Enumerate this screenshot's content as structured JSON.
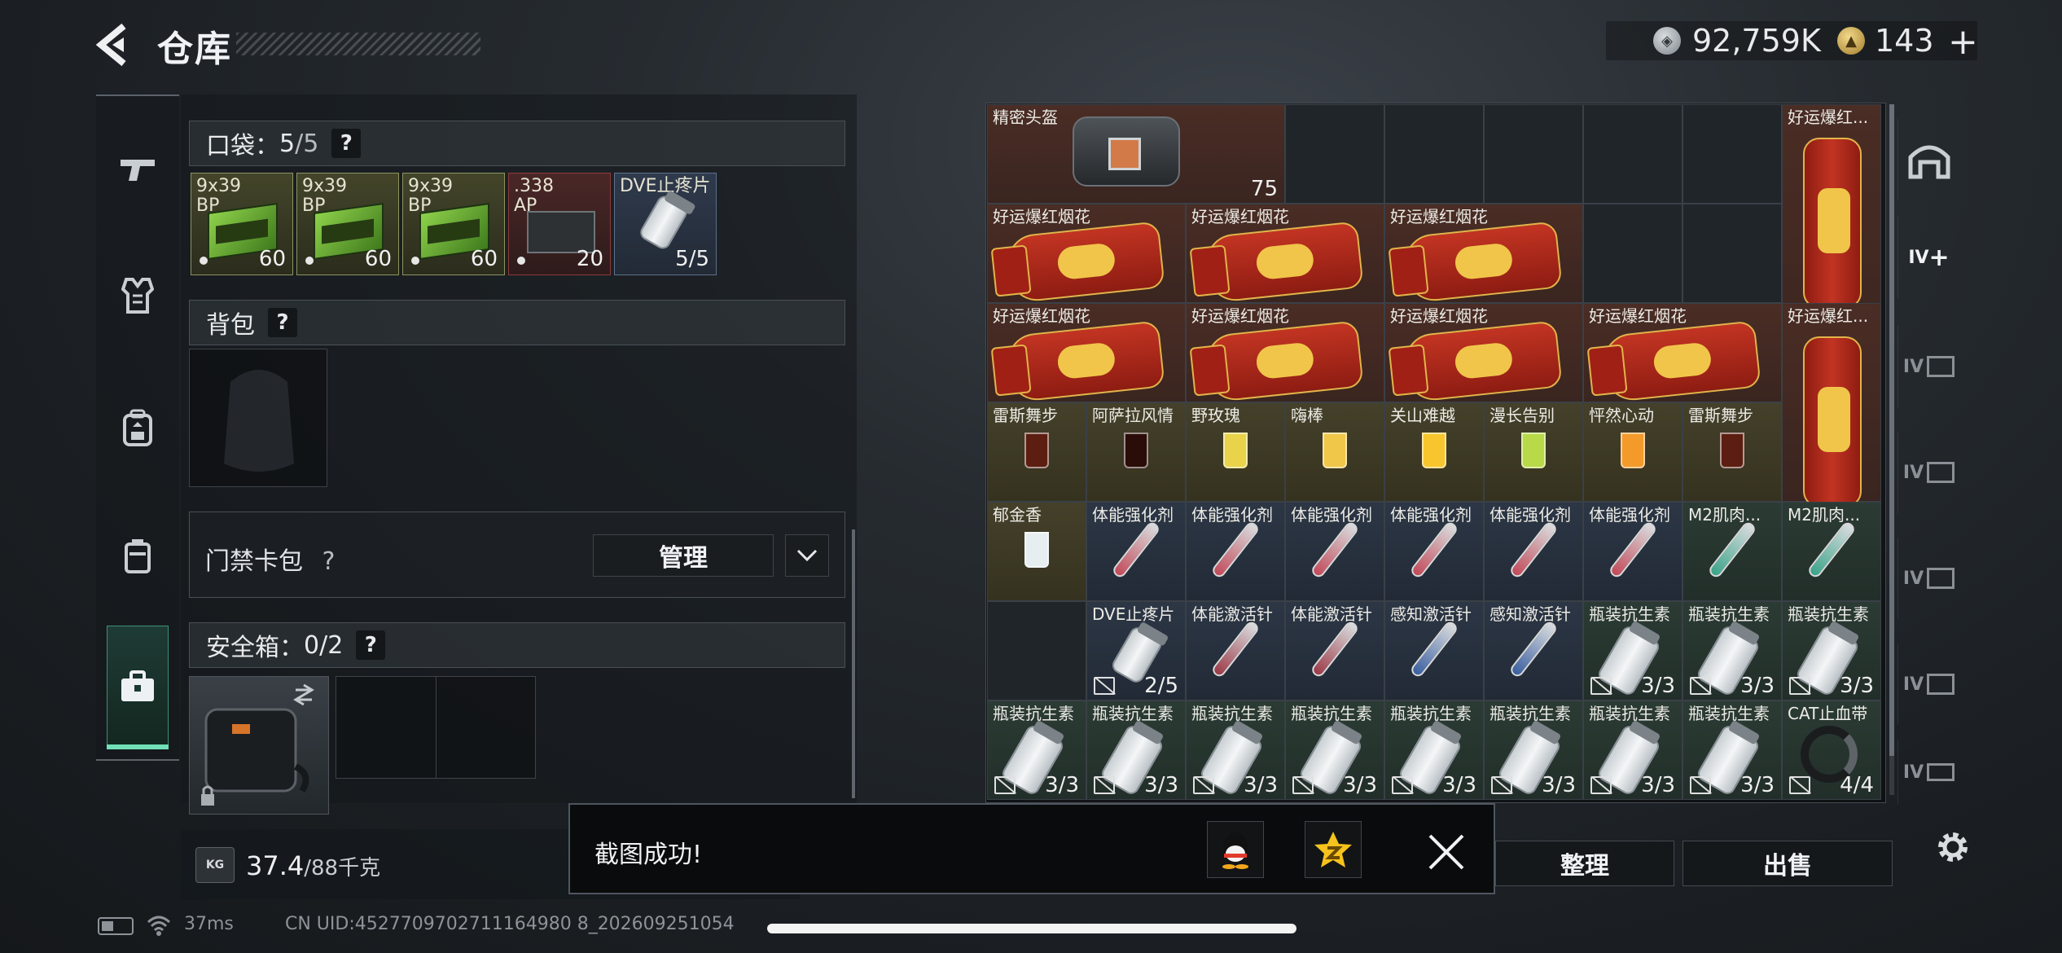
{
  "header": {
    "title": "仓库",
    "currency": [
      {
        "name": "coin-icon",
        "value": "92,759K"
      },
      {
        "name": "gold-coin-icon",
        "value": "143"
      }
    ],
    "topup_label": "+"
  },
  "left_nav": {
    "items": [
      "rifle-icon",
      "armor-vest-icon",
      "backpack-icon",
      "container-icon",
      "briefcase-icon"
    ],
    "active": "briefcase-icon"
  },
  "pocket": {
    "title": "口袋",
    "capacity_used": "5",
    "capacity_total": "/5",
    "help": "?",
    "items": [
      {
        "label": "9x39\nBP",
        "count": "60"
      },
      {
        "label": "9x39\nBP",
        "count": "60"
      },
      {
        "label": "9x39\nBP",
        "count": "60"
      },
      {
        "label": ".338\nAP",
        "count": "20"
      },
      {
        "label": "DVE止疼片",
        "count": "5/5"
      }
    ]
  },
  "backpack": {
    "title": "背包",
    "help": "?"
  },
  "keycard": {
    "label": "门禁卡包",
    "help": "?",
    "manage": "管理"
  },
  "safebox": {
    "title": "安全箱",
    "capacity": "0/2",
    "help": "?"
  },
  "weight": {
    "icon_text": "KG",
    "current": "37.4",
    "max": "/88千克"
  },
  "grid": {
    "cells": [
      {
        "label": "精密头盔",
        "count": "75",
        "shield": true
      },
      {
        "label": "好运爆红...",
        "count": ""
      },
      {
        "label": "好运爆红烟花",
        "count": ""
      },
      {
        "label": "好运爆红烟花",
        "count": ""
      },
      {
        "label": "好运爆红烟花",
        "count": ""
      },
      {
        "label": "好运爆红烟花",
        "count": ""
      },
      {
        "label": "好运爆红烟花",
        "count": ""
      },
      {
        "label": "好运爆红烟花",
        "count": ""
      },
      {
        "label": "好运爆红烟花",
        "count": ""
      },
      {
        "label": "好运爆红...",
        "count": ""
      },
      {
        "label": "雷斯舞步",
        "count": ""
      },
      {
        "label": "阿萨拉风情",
        "count": ""
      },
      {
        "label": "野玫瑰",
        "count": ""
      },
      {
        "label": "嗨棒",
        "count": ""
      },
      {
        "label": "关山难越",
        "count": ""
      },
      {
        "label": "漫长告别",
        "count": ""
      },
      {
        "label": "怦然心动",
        "count": ""
      },
      {
        "label": "雷斯舞步",
        "count": ""
      },
      {
        "label": "郁金香",
        "count": ""
      },
      {
        "label": "体能强化剂",
        "count": ""
      },
      {
        "label": "体能强化剂",
        "count": ""
      },
      {
        "label": "体能强化剂",
        "count": ""
      },
      {
        "label": "体能强化剂",
        "count": ""
      },
      {
        "label": "体能强化剂",
        "count": ""
      },
      {
        "label": "体能强化剂",
        "count": ""
      },
      {
        "label": "M2肌肉...",
        "count": ""
      },
      {
        "label": "M2肌肉...",
        "count": ""
      },
      {
        "label": "DVE止疼片",
        "count": "2/5"
      },
      {
        "label": "体能激活针",
        "count": ""
      },
      {
        "label": "体能激活针",
        "count": ""
      },
      {
        "label": "感知激活针",
        "count": ""
      },
      {
        "label": "感知激活针",
        "count": ""
      },
      {
        "label": "瓶装抗生素",
        "count": "3/3"
      },
      {
        "label": "瓶装抗生素",
        "count": "3/3"
      },
      {
        "label": "瓶装抗生素",
        "count": "3/3"
      },
      {
        "label": "瓶装抗生素",
        "count": "3/3"
      },
      {
        "label": "瓶装抗生素",
        "count": "3/3"
      },
      {
        "label": "瓶装抗生素",
        "count": "3/3"
      },
      {
        "label": "瓶装抗生素",
        "count": "3/3"
      },
      {
        "label": "瓶装抗生素",
        "count": "3/3"
      },
      {
        "label": "瓶装抗生素",
        "count": "3/3"
      },
      {
        "label": "瓶装抗生素",
        "count": "3/3"
      },
      {
        "label": "瓶装抗生素",
        "count": "3/3"
      },
      {
        "label": "CAT止血带",
        "count": "4/4"
      }
    ]
  },
  "right_rail": {
    "items": [
      "bunker-icon",
      "add-tab-icon",
      "tab-icon",
      "tab-icon",
      "tab-icon",
      "tab-icon",
      "tab-icon"
    ],
    "add_tab_text": "IV",
    "tab_text": "IV"
  },
  "actions": {
    "sort": "整理",
    "sell": "出售"
  },
  "toast": {
    "message": "截图成功!",
    "share": [
      "qq-icon",
      "qzone-icon"
    ]
  },
  "status": {
    "ping": "37ms",
    "uid": "CN UID:4527709702711164980 8_202609251054"
  }
}
